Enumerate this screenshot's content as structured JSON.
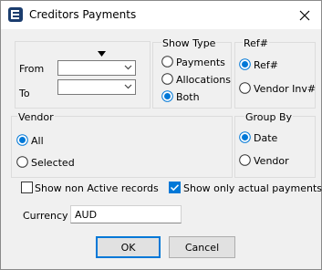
{
  "window": {
    "title": "Creditors Payments"
  },
  "date_range": {
    "from_label": "From",
    "to_label": "To",
    "from_value": "",
    "to_value": ""
  },
  "show_type": {
    "legend": "Show Type",
    "options": [
      {
        "label": "Payments",
        "checked": false
      },
      {
        "label": "Allocations",
        "checked": false
      },
      {
        "label": "Both",
        "checked": true
      }
    ]
  },
  "ref": {
    "legend": "Ref#",
    "options": [
      {
        "label": "Ref#",
        "checked": true
      },
      {
        "label": "Vendor Inv#",
        "checked": false
      }
    ]
  },
  "vendor": {
    "legend": "Vendor",
    "options": [
      {
        "label": "All",
        "checked": true
      },
      {
        "label": "Selected",
        "checked": false
      }
    ]
  },
  "group_by": {
    "legend": "Group By",
    "options": [
      {
        "label": "Date",
        "checked": true
      },
      {
        "label": "Vendor",
        "checked": false
      }
    ]
  },
  "options": {
    "show_non_active": {
      "label": "Show non Active records",
      "checked": false
    },
    "show_actual_payments": {
      "label": "Show only actual payments",
      "checked": true
    }
  },
  "currency": {
    "label": "Currency",
    "value": "AUD"
  },
  "buttons": {
    "ok": "OK",
    "cancel": "Cancel"
  },
  "colors": {
    "accent": "#0078d7",
    "group_border": "#dcdcdc",
    "dialog_bg": "#f0f0f0"
  }
}
